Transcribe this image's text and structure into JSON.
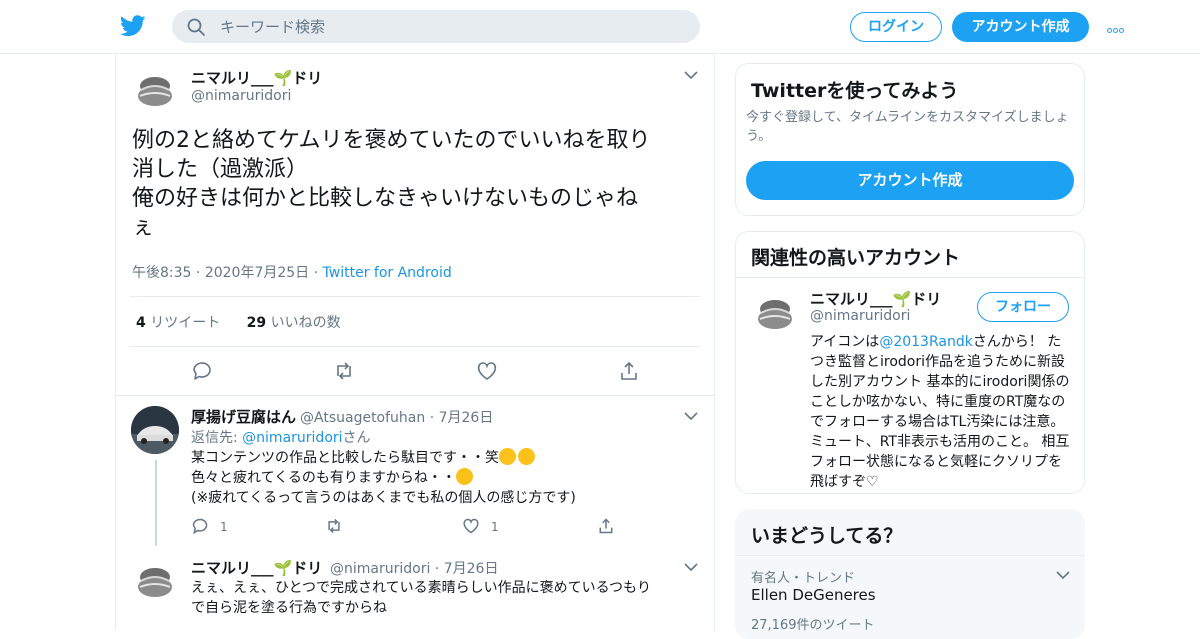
{
  "header": {
    "search_placeholder": "キーワード検索",
    "login_label": "ログイン",
    "signup_label": "アカウント作成"
  },
  "tweet": {
    "display_name": "ニマルリ___",
    "display_name_suffix": "ドリ",
    "handle": "@nimaruridori",
    "text_lines": [
      "例の2と絡めてケムリを褒めていたのでいいねを取り",
      "消した（過激派）",
      "俺の好きは何かと比較しなきゃいけないものじゃね",
      "ぇ"
    ],
    "time": "午後8:35",
    "date": "2020年7月25日",
    "source": "Twitter for Android",
    "retweets_count": "4",
    "retweets_label": "リツイート",
    "likes_count": "29",
    "likes_label": "いいねの数"
  },
  "replies": [
    {
      "display_name": "厚揚げ豆腐はん",
      "handle": "@Atsuagetofuhan",
      "date": "7月26日",
      "reply_to_prefix": "返信先:",
      "reply_to_handle": "@nimaruridori",
      "reply_to_suffix": "さん",
      "lines": [
        "某コンテンツの作品と比較したら駄目です・・笑",
        "色々と疲れてくるのも有りますからね・・",
        "(※疲れてくるって言うのはあくまでも私の個人の感じ方です)"
      ],
      "reply_count": "1",
      "like_count": "1"
    },
    {
      "display_name": "ニマルリ___",
      "display_name_suffix": "ドリ",
      "handle": "@nimaruridori",
      "date": "7月26日",
      "lines": [
        "えぇ、えぇ、ひとつで完成されている素晴らしい作品に褒めているつもり",
        "で自ら泥を塗る行為ですからね"
      ]
    }
  ],
  "sidebar": {
    "try_twitter": {
      "title": "Twitterを使ってみよう",
      "description": "今すぐ登録して、タイムラインをカスタマイズしましょう。",
      "button": "アカウント作成"
    },
    "related": {
      "title": "関連性の高いアカウント",
      "display_name": "ニマルリ___",
      "display_name_suffix": "ドリ",
      "handle": "@nimaruridori",
      "follow_label": "フォロー",
      "bio_prefix": "アイコンは",
      "bio_link": "@2013Randk",
      "bio_rest": "さんから！ たつき監督とirodori作品を追うために新設した別アカウント 基本的にirodori関係のことしか呟かない、特に重度のRT魔なのでフォローする場合はTL汚染には注意。ミュート、RT非表示も活用のこと。 相互フォロー状態になると気軽にクソリプを飛ばすぞ♡"
    },
    "trends": {
      "title": "いまどうしてる？",
      "category": "有名人・トレンド",
      "topic": "Ellen DeGeneres",
      "count": "27,169件のツイート"
    }
  },
  "colors": {
    "accent": "#1da1f2",
    "link": "#1b95e0",
    "muted": "#657786",
    "border": "#e6ecf0"
  }
}
